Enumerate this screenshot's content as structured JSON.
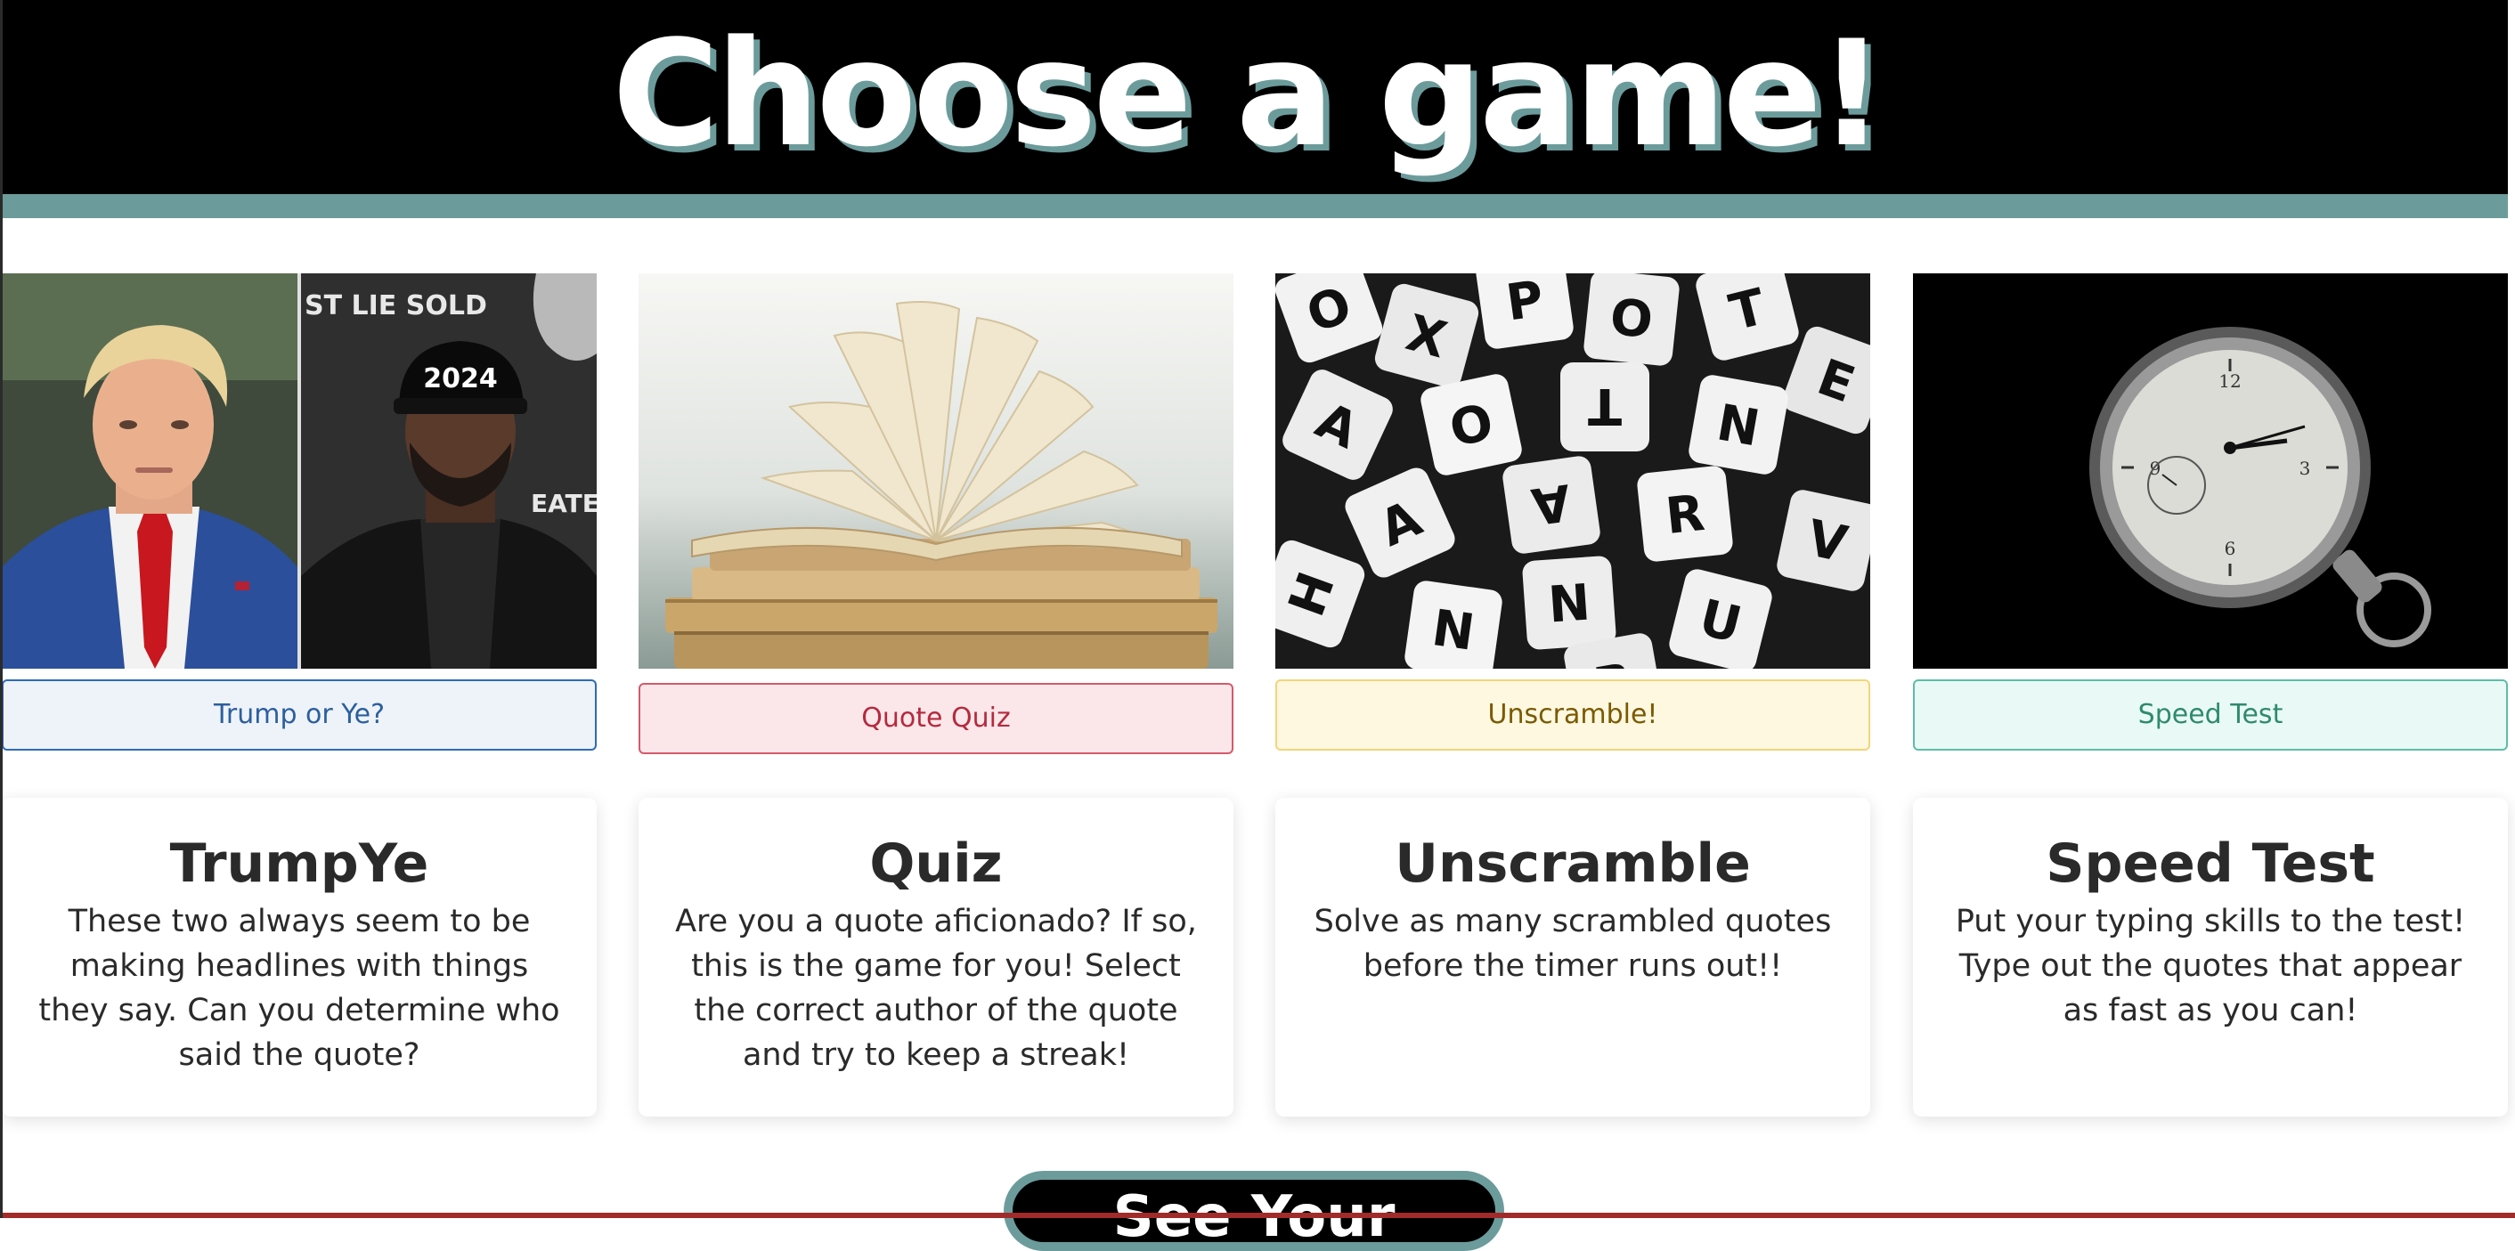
{
  "header": {
    "title": "Choose a game!"
  },
  "games": [
    {
      "image_icon": "trump-and-ye-photo",
      "image_caption_left": "ST LIE SOLD",
      "image_hat_text": "2024",
      "image_caption_right": "EATEST",
      "button_label": "Trump or Ye?",
      "card_title": "TrumpYe",
      "card_text": "These two always seem to be making headlines with things they say. Can you determine who said the quote?"
    },
    {
      "image_icon": "open-books-photo",
      "button_label": "Quote Quiz",
      "card_title": "Quiz",
      "card_text": "Are you a quote aficionado? If so, this is the game for you! Select the correct author of the quote and try to keep a streak!"
    },
    {
      "image_icon": "letter-tiles-photo",
      "button_label": "Unscramble!",
      "card_title": "Unscramble",
      "card_text": "Solve as many scrambled quotes before the timer runs out!!"
    },
    {
      "image_icon": "pocket-watch-photo",
      "button_label": "Speed Test",
      "card_title": "Speed Test",
      "card_text": "Put your typing skills to the test! Type out the quotes that appear as fast as you can!"
    }
  ],
  "footer": {
    "stats_button_label": "See Your Stats!"
  },
  "colors": {
    "header_bg": "#000000",
    "accent_teal": "#6c9b9b",
    "bottom_band": "#a12a2a"
  }
}
